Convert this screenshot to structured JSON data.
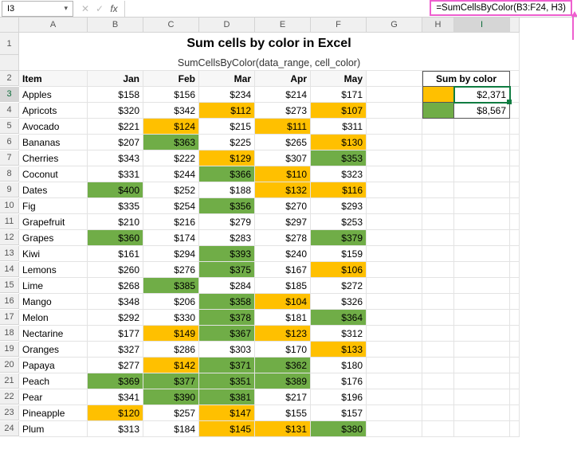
{
  "namebox": {
    "value": "I3"
  },
  "formula": "=SumCellsByColor(B3:F24, H3)",
  "title1": "Sum cells by color in Excel",
  "title2": "SumCellsByColor(data_range, cell_color)",
  "columns": [
    "A",
    "B",
    "C",
    "D",
    "E",
    "F",
    "G",
    "H",
    "I"
  ],
  "headers": {
    "item": "Item",
    "months": [
      "Jan",
      "Feb",
      "Mar",
      "Apr",
      "May"
    ]
  },
  "sum_header": "Sum by color",
  "sum_results": [
    {
      "color": "orange",
      "value": "$2,371"
    },
    {
      "color": "green",
      "value": "$8,567"
    }
  ],
  "rows": [
    {
      "n": 3,
      "item": "Apples",
      "v": [
        "$158",
        "$156",
        "$234",
        "$214",
        "$171"
      ],
      "c": [
        "",
        "",
        "",
        "",
        ""
      ]
    },
    {
      "n": 4,
      "item": "Apricots",
      "v": [
        "$320",
        "$342",
        "$112",
        "$273",
        "$107"
      ],
      "c": [
        "",
        "",
        "orange",
        "",
        "orange"
      ]
    },
    {
      "n": 5,
      "item": "Avocado",
      "v": [
        "$221",
        "$124",
        "$215",
        "$111",
        "$311"
      ],
      "c": [
        "",
        "orange",
        "",
        "orange",
        ""
      ]
    },
    {
      "n": 6,
      "item": "Bananas",
      "v": [
        "$207",
        "$363",
        "$225",
        "$265",
        "$130"
      ],
      "c": [
        "",
        "green",
        "",
        "",
        "orange"
      ]
    },
    {
      "n": 7,
      "item": "Cherries",
      "v": [
        "$343",
        "$222",
        "$129",
        "$307",
        "$353"
      ],
      "c": [
        "",
        "",
        "orange",
        "",
        "green"
      ]
    },
    {
      "n": 8,
      "item": "Coconut",
      "v": [
        "$331",
        "$244",
        "$366",
        "$110",
        "$323"
      ],
      "c": [
        "",
        "",
        "green",
        "orange",
        ""
      ]
    },
    {
      "n": 9,
      "item": "Dates",
      "v": [
        "$400",
        "$252",
        "$188",
        "$132",
        "$116"
      ],
      "c": [
        "green",
        "",
        "",
        "orange",
        "orange"
      ]
    },
    {
      "n": 10,
      "item": "Fig",
      "v": [
        "$335",
        "$254",
        "$356",
        "$270",
        "$293"
      ],
      "c": [
        "",
        "",
        "green",
        "",
        ""
      ]
    },
    {
      "n": 11,
      "item": "Grapefruit",
      "v": [
        "$210",
        "$216",
        "$279",
        "$297",
        "$253"
      ],
      "c": [
        "",
        "",
        "",
        "",
        ""
      ]
    },
    {
      "n": 12,
      "item": "Grapes",
      "v": [
        "$360",
        "$174",
        "$283",
        "$278",
        "$379"
      ],
      "c": [
        "green",
        "",
        "",
        "",
        "green"
      ]
    },
    {
      "n": 13,
      "item": "Kiwi",
      "v": [
        "$161",
        "$294",
        "$393",
        "$240",
        "$159"
      ],
      "c": [
        "",
        "",
        "green",
        "",
        ""
      ]
    },
    {
      "n": 14,
      "item": "Lemons",
      "v": [
        "$260",
        "$276",
        "$375",
        "$167",
        "$106"
      ],
      "c": [
        "",
        "",
        "green",
        "",
        "orange"
      ]
    },
    {
      "n": 15,
      "item": "Lime",
      "v": [
        "$268",
        "$385",
        "$284",
        "$185",
        "$272"
      ],
      "c": [
        "",
        "green",
        "",
        "",
        ""
      ]
    },
    {
      "n": 16,
      "item": "Mango",
      "v": [
        "$348",
        "$206",
        "$358",
        "$104",
        "$326"
      ],
      "c": [
        "",
        "",
        "green",
        "orange",
        ""
      ]
    },
    {
      "n": 17,
      "item": "Melon",
      "v": [
        "$292",
        "$330",
        "$378",
        "$181",
        "$364"
      ],
      "c": [
        "",
        "",
        "green",
        "",
        "green"
      ]
    },
    {
      "n": 18,
      "item": "Nectarine",
      "v": [
        "$177",
        "$149",
        "$367",
        "$123",
        "$312"
      ],
      "c": [
        "",
        "orange",
        "green",
        "orange",
        ""
      ]
    },
    {
      "n": 19,
      "item": "Oranges",
      "v": [
        "$327",
        "$286",
        "$303",
        "$170",
        "$133"
      ],
      "c": [
        "",
        "",
        "",
        "",
        "orange"
      ]
    },
    {
      "n": 20,
      "item": "Papaya",
      "v": [
        "$277",
        "$142",
        "$371",
        "$362",
        "$180"
      ],
      "c": [
        "",
        "orange",
        "green",
        "green",
        ""
      ]
    },
    {
      "n": 21,
      "item": "Peach",
      "v": [
        "$369",
        "$377",
        "$351",
        "$389",
        "$176"
      ],
      "c": [
        "green",
        "green",
        "green",
        "green",
        ""
      ]
    },
    {
      "n": 22,
      "item": "Pear",
      "v": [
        "$341",
        "$390",
        "$381",
        "$217",
        "$196"
      ],
      "c": [
        "",
        "green",
        "green",
        "",
        ""
      ]
    },
    {
      "n": 23,
      "item": "Pineapple",
      "v": [
        "$120",
        "$257",
        "$147",
        "$155",
        "$157"
      ],
      "c": [
        "orange",
        "",
        "orange",
        "",
        ""
      ]
    },
    {
      "n": 24,
      "item": "Plum",
      "v": [
        "$313",
        "$184",
        "$145",
        "$131",
        "$380"
      ],
      "c": [
        "",
        "",
        "orange",
        "orange",
        "green"
      ]
    }
  ],
  "chart_data": {
    "type": "table",
    "title": "Sum cells by color in Excel",
    "columns": [
      "Item",
      "Jan",
      "Feb",
      "Mar",
      "Apr",
      "May"
    ],
    "cell_colors_legend": {
      "": "none",
      "orange": "#ffc000",
      "green": "#70ad47"
    },
    "data": [
      [
        "Apples",
        158,
        156,
        234,
        214,
        171
      ],
      [
        "Apricots",
        320,
        342,
        112,
        273,
        107
      ],
      [
        "Avocado",
        221,
        124,
        215,
        111,
        311
      ],
      [
        "Bananas",
        207,
        363,
        225,
        265,
        130
      ],
      [
        "Cherries",
        343,
        222,
        129,
        307,
        353
      ],
      [
        "Coconut",
        331,
        244,
        366,
        110,
        323
      ],
      [
        "Dates",
        400,
        252,
        188,
        132,
        116
      ],
      [
        "Fig",
        335,
        254,
        356,
        270,
        293
      ],
      [
        "Grapefruit",
        210,
        216,
        279,
        297,
        253
      ],
      [
        "Grapes",
        360,
        174,
        283,
        278,
        379
      ],
      [
        "Kiwi",
        161,
        294,
        393,
        240,
        159
      ],
      [
        "Lemons",
        260,
        276,
        375,
        167,
        106
      ],
      [
        "Lime",
        268,
        385,
        284,
        185,
        272
      ],
      [
        "Mango",
        348,
        206,
        358,
        104,
        326
      ],
      [
        "Melon",
        292,
        330,
        378,
        181,
        364
      ],
      [
        "Nectarine",
        177,
        149,
        367,
        123,
        312
      ],
      [
        "Oranges",
        327,
        286,
        303,
        170,
        133
      ],
      [
        "Papaya",
        277,
        142,
        371,
        362,
        180
      ],
      [
        "Peach",
        369,
        377,
        351,
        389,
        176
      ],
      [
        "Pear",
        341,
        390,
        381,
        217,
        196
      ],
      [
        "Pineapple",
        120,
        257,
        147,
        155,
        157
      ],
      [
        "Plum",
        313,
        184,
        145,
        131,
        380
      ]
    ],
    "sum_by_color": {
      "orange": 2371,
      "green": 8567
    }
  }
}
